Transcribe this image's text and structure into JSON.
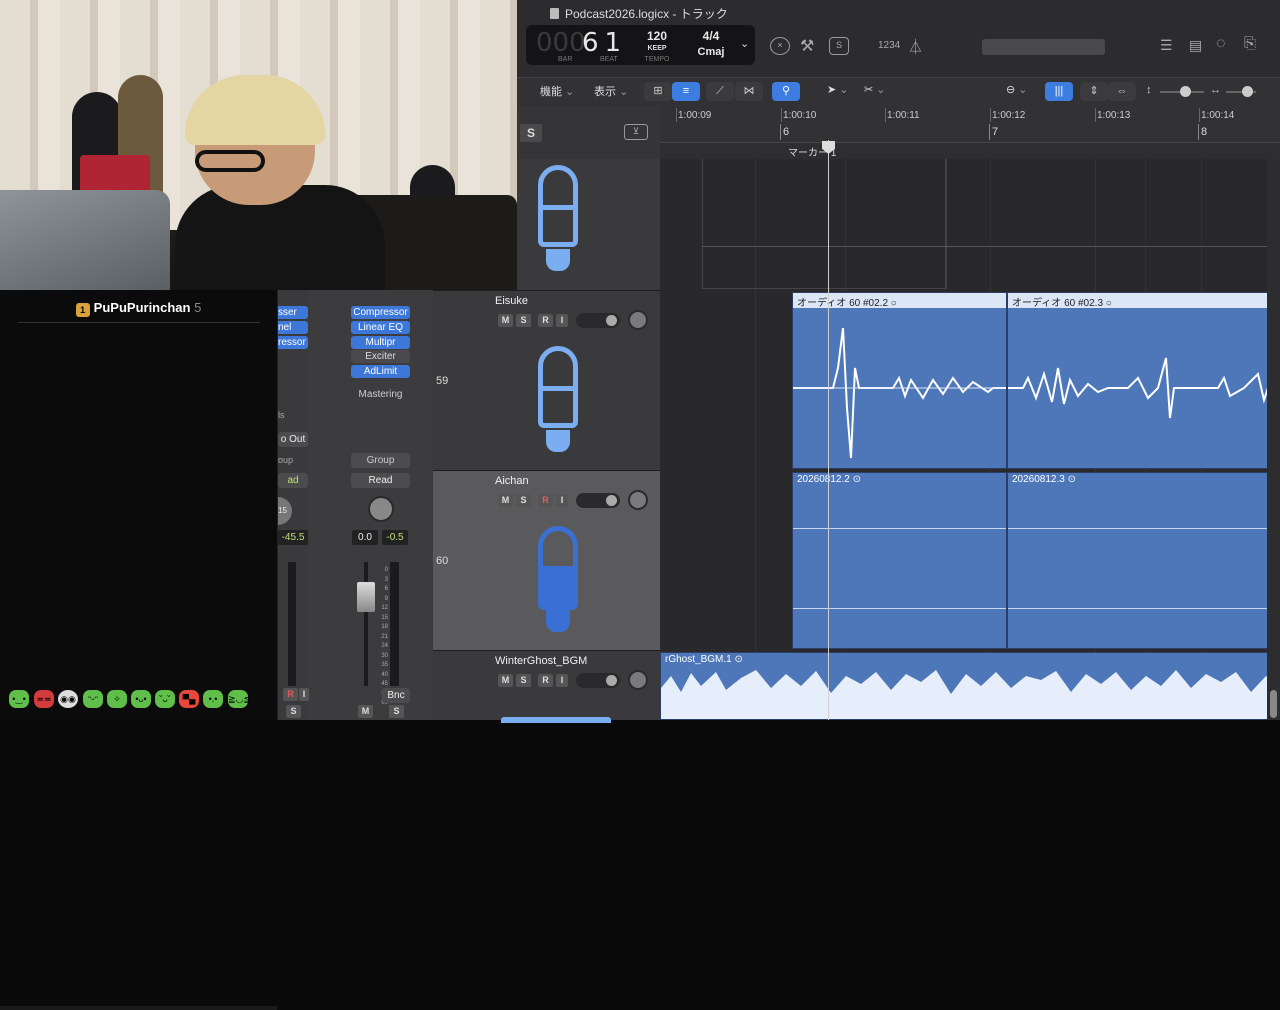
{
  "window": {
    "title": "Podcast2026.logicx - トラック"
  },
  "lcd": {
    "bar_beat": "61",
    "bar_dim": "000",
    "bar_label": "BAR",
    "beat_label": "BEAT",
    "tempo": "120",
    "tempo_mode": "KEEP",
    "tempo_label": "TEMPO",
    "time_sig": "4/4",
    "key": "Cmaj",
    "count_in": "1234"
  },
  "toolbar": {
    "functions_label": "機能",
    "view_label": "表示"
  },
  "ruler": {
    "times": [
      "1:00:09",
      "1:00:10",
      "1:00:11",
      "1:00:12",
      "1:00:13",
      "1:00:14"
    ],
    "bars": [
      "6",
      "7",
      "8"
    ],
    "marker": "マーカー 1"
  },
  "tracks": [
    {
      "name": "Eisuke",
      "number": "59",
      "m": "M",
      "s": "S",
      "r": "R",
      "i": "I"
    },
    {
      "name": "Aichan",
      "number": "60",
      "m": "M",
      "s": "S",
      "r": "R",
      "i": "I"
    },
    {
      "name": "WinterGhost_BGM",
      "m": "M",
      "s": "S",
      "r": "R",
      "i": "I"
    }
  ],
  "top_track": {
    "solo_label": "S"
  },
  "regions": {
    "eisuke": [
      "オーディオ 60 #02.2",
      "オーディオ 60 #02.3"
    ],
    "aichan": [
      "20260812.2",
      "20260812.3"
    ],
    "bgm": [
      "rGhost_BGM.1"
    ]
  },
  "mixer": {
    "left_plugins": [
      "sser",
      "nel EQ",
      "ressor"
    ],
    "right_plugins": [
      "Compressor",
      "Linear EQ",
      "Multipr",
      "Exciter",
      "AdLimit"
    ],
    "right_plugins_off": [
      false,
      false,
      false,
      true,
      false
    ],
    "mastering_label": "Mastering",
    "left_send": "ls",
    "left_output": "o Out",
    "left_group": "oup",
    "left_read": "ad",
    "right_group": "Group",
    "right_read": "Read",
    "left_pan": "15",
    "left_gain": "-45.5",
    "right_pan_val": "0.0",
    "right_gain": "-0.5",
    "bnc": "Bnc",
    "m": "M",
    "s": "S",
    "r": "R",
    "i": "I",
    "scale": [
      "0",
      "3",
      "6",
      "9",
      "12",
      "15",
      "18",
      "21",
      "24",
      "30",
      "35",
      "40",
      "45",
      "50",
      "60"
    ]
  },
  "chat": {
    "username": "PuPuPurinchan",
    "count": "5",
    "badge": "1"
  },
  "colors": {
    "accent": "#3d7de0",
    "region": "#4d77b8",
    "mic": "#7aaef0"
  }
}
